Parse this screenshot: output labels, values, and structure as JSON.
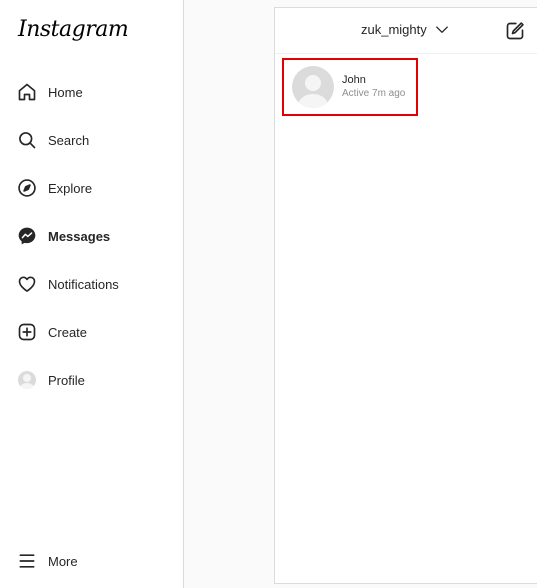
{
  "app": {
    "logo_text": "Instagram"
  },
  "sidebar": {
    "items": [
      {
        "label": "Home",
        "icon": "home-icon"
      },
      {
        "label": "Search",
        "icon": "search-icon"
      },
      {
        "label": "Explore",
        "icon": "compass-icon"
      },
      {
        "label": "Messages",
        "icon": "messenger-icon",
        "active": true
      },
      {
        "label": "Notifications",
        "icon": "heart-icon"
      },
      {
        "label": "Create",
        "icon": "plus-square-icon"
      },
      {
        "label": "Profile",
        "icon": "avatar-icon"
      }
    ],
    "more_label": "More"
  },
  "inbox": {
    "account_name": "zuk_mighty",
    "threads": [
      {
        "name": "John",
        "status": "Active 7m ago"
      }
    ]
  },
  "colors": {
    "highlight_border": "#e30000",
    "text_primary": "#262626",
    "text_secondary": "#8e8e8e",
    "border": "#dbdbdb"
  }
}
